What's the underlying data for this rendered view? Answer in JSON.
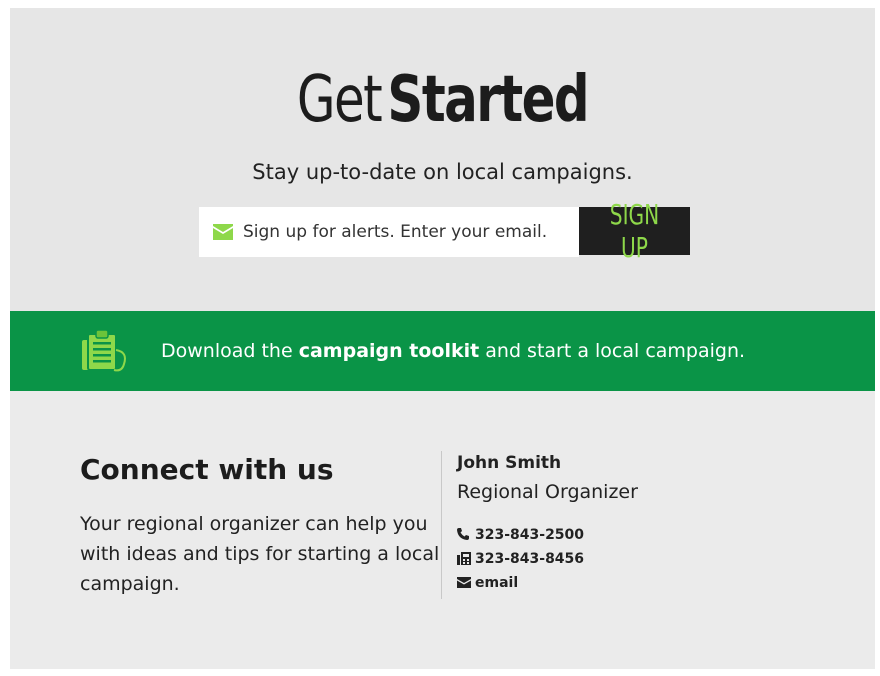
{
  "hero": {
    "title_light": "Get",
    "title_bold": "Started",
    "subtitle": "Stay up-to-date on local campaigns.",
    "email_placeholder": "Sign up for alerts. Enter your email.",
    "signup_label": "SIGN UP"
  },
  "toolkit": {
    "prefix": "Download the ",
    "link": "campaign toolkit",
    "suffix": " and start a local campaign.",
    "icon": "clipboard-icon"
  },
  "connect": {
    "title": "Connect with us",
    "body": "Your regional organizer can help you with ideas and tips for starting a local campaign."
  },
  "contact": {
    "name": "John Smith",
    "role": "Regional Organizer",
    "phone": "323-843-2500",
    "fax": "323-843-8456",
    "email_label": "email"
  },
  "colors": {
    "page_bg": "#ebebeb",
    "banner_green": "#0a9447",
    "accent_green": "#8ed84a",
    "button_dark": "#1f1f1f"
  }
}
